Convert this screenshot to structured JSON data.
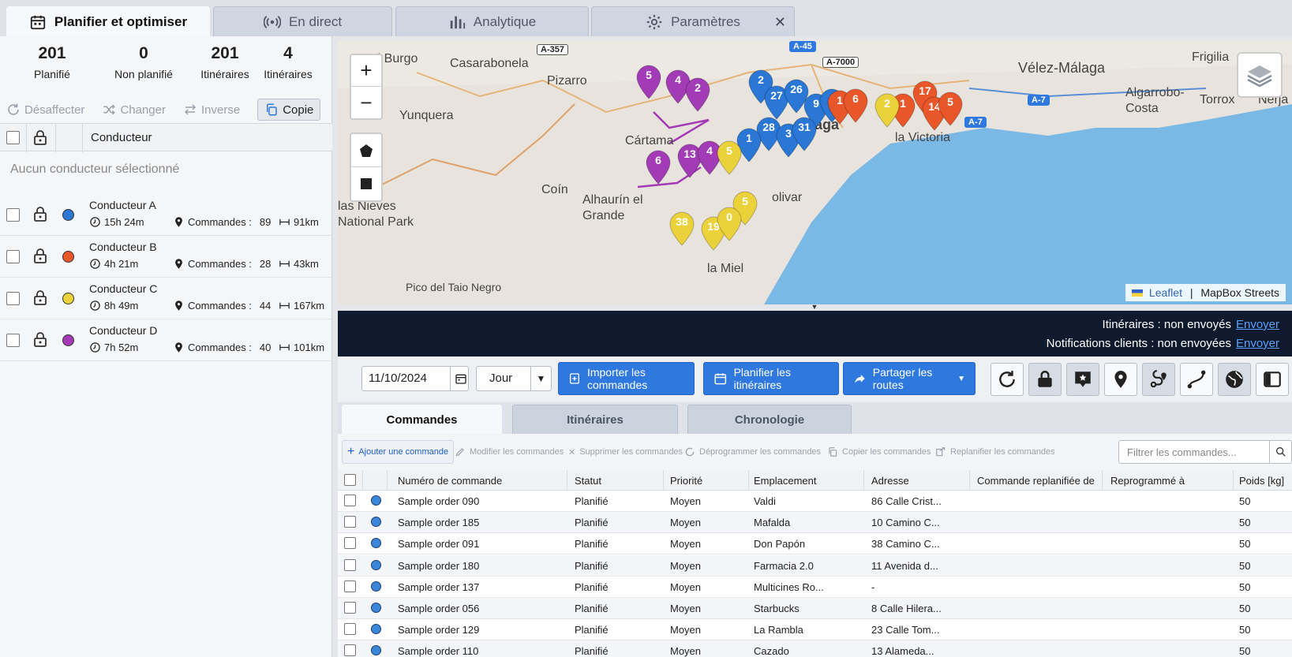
{
  "top_tabs": [
    {
      "label": "Planifier et optimiser",
      "icon": "calendar-icon",
      "active": true
    },
    {
      "label": "En direct",
      "icon": "broadcast-icon"
    },
    {
      "label": "Analytique",
      "icon": "bar-chart-icon"
    },
    {
      "label": "Paramètres",
      "icon": "gear-icon"
    }
  ],
  "stats": [
    {
      "value": "201",
      "label": "Planifié"
    },
    {
      "value": "0",
      "label": "Non planifié"
    },
    {
      "value": "201",
      "label": "Itinéraires"
    },
    {
      "value": "4",
      "label": "Itinéraires"
    }
  ],
  "driver_actions": {
    "unassign": "Désaffecter",
    "change": "Changer",
    "reverse": "Inverse",
    "copy": "Copie"
  },
  "drivers_header": "Conducteur",
  "no_driver_selected": "Aucun conducteur sélectionné",
  "drivers": [
    {
      "name": "Conducteur A",
      "time": "15h 24m",
      "orders_label": "Commandes :",
      "orders": "89",
      "distance": "91km",
      "color": "#2a77d6"
    },
    {
      "name": "Conducteur B",
      "time": "4h 21m",
      "orders_label": "Commandes :",
      "orders": "28",
      "distance": "43km",
      "color": "#e8562a"
    },
    {
      "name": "Conducteur C",
      "time": "8h 49m",
      "orders_label": "Commandes :",
      "orders": "44",
      "distance": "167km",
      "color": "#ecd23a"
    },
    {
      "name": "Conducteur D",
      "time": "7h 52m",
      "orders_label": "Commandes :",
      "orders": "40",
      "distance": "101km",
      "color": "#a23bb5"
    }
  ],
  "map": {
    "labels": [
      "El Burgo",
      "Casarabonela",
      "Pizarro",
      "Yunquera",
      "Cártama",
      "Coín",
      "Alhaurín el Grande",
      "las Nieves National Park",
      "Vélez-Málaga",
      "Frigilia",
      "Algarrobo-Costa",
      "Torrox",
      "Nerja",
      "la Victoria",
      "Pico del Taio Negro",
      "aga",
      "olivar",
      "la Miel"
    ],
    "roads": [
      "A-357",
      "A-45",
      "A-7000",
      "A-7",
      "A-7"
    ],
    "attribution_link": "Leaflet",
    "attribution_text": "MapBox Streets",
    "zoom_in": "+",
    "zoom_out": "−"
  },
  "status": {
    "routes_label": "Itinéraires : non envoyés",
    "notif_label": "Notifications clients : non envoyées",
    "send_link": "Envoyer"
  },
  "toolbar": {
    "date": "11/10/2024",
    "period": "Jour",
    "import_label": "Importer les commandes",
    "plan_label": "Planifier les itinéraires",
    "share_label": "Partager les routes"
  },
  "sub_tabs": [
    "Commandes",
    "Itinéraires",
    "Chronologie"
  ],
  "order_actions": [
    "Ajouter une commande",
    "Modifier les commandes",
    "Supprimer les commandes",
    "Déprogrammer les commandes",
    "Copier les commandes",
    "Replanifier les commandes"
  ],
  "filter_placeholder": "Filtrer les commandes...",
  "table": {
    "columns": [
      "Numéro de commande",
      "Statut",
      "Priorité",
      "Emplacement",
      "Adresse",
      "Commande replanifiée de",
      "Reprogrammé à",
      "Poids [kg]"
    ],
    "rows": [
      [
        "Sample order 090",
        "Planifié",
        "Moyen",
        "Valdi",
        "86 Calle Crist...",
        "",
        "",
        "50"
      ],
      [
        "Sample order 185",
        "Planifié",
        "Moyen",
        "Mafalda",
        "10 Camino C...",
        "",
        "",
        "50"
      ],
      [
        "Sample order 091",
        "Planifié",
        "Moyen",
        "Don Papón",
        "38 Camino C...",
        "",
        "",
        "50"
      ],
      [
        "Sample order 180",
        "Planifié",
        "Moyen",
        "Farmacia 2.0",
        "11 Avenida d...",
        "",
        "",
        "50"
      ],
      [
        "Sample order 137",
        "Planifié",
        "Moyen",
        "Multicines Ro...",
        "-",
        "",
        "",
        "50"
      ],
      [
        "Sample order 056",
        "Planifié",
        "Moyen",
        "Starbucks",
        "8 Calle Hilera...",
        "",
        "",
        "50"
      ],
      [
        "Sample order 129",
        "Planifié",
        "Moyen",
        "La Rambla",
        "23 Calle Tom...",
        "",
        "",
        "50"
      ],
      [
        "Sample order 110",
        "Planifié",
        "Moyen",
        "Cazado",
        "13 Alameda...",
        "",
        "",
        "50"
      ]
    ]
  }
}
